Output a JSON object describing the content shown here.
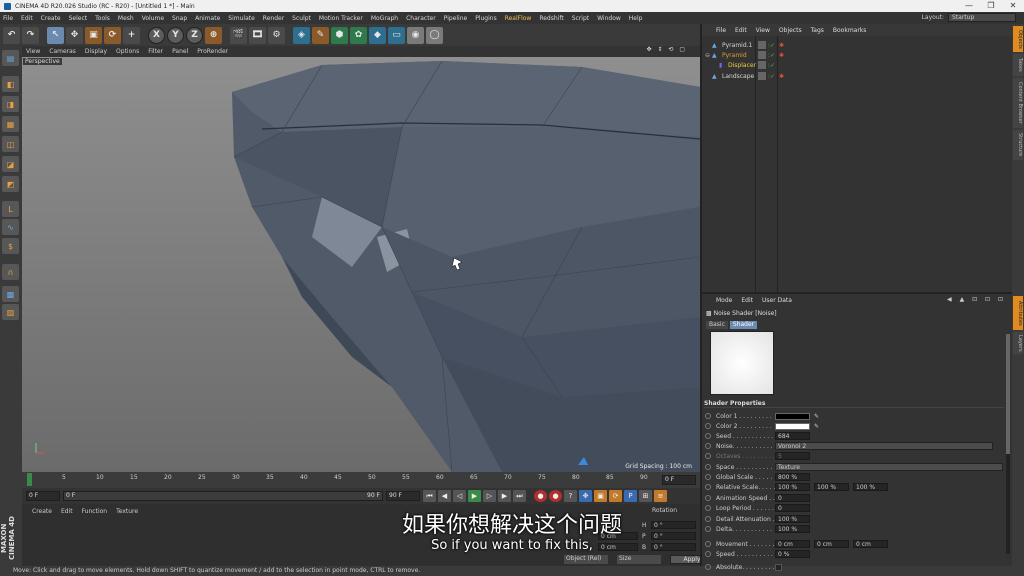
{
  "title_bar": {
    "title": "CINEMA 4D R20.026 Studio (RC - R20) - [Untitled 1 *] - Main",
    "controls": [
      "—",
      "❐",
      "✕"
    ]
  },
  "menu": {
    "items": [
      "File",
      "Edit",
      "Create",
      "Select",
      "Tools",
      "Mesh",
      "Volume",
      "Snap",
      "Animate",
      "Simulate",
      "Render",
      "Sculpt",
      "Motion Tracker",
      "MoGraph",
      "Character",
      "Pipeline",
      "Plugins",
      "RealFlow",
      "Redshift",
      "Script",
      "Window",
      "Help"
    ],
    "highlight": "RealFlow",
    "layout_label": "Layout:",
    "layout_value": "Startup"
  },
  "toolbar": {
    "axes": [
      "X",
      "Y",
      "Z"
    ]
  },
  "viewport": {
    "menu": [
      "View",
      "Cameras",
      "Display",
      "Options",
      "Filter",
      "Panel",
      "ProRender"
    ],
    "label": "Perspective",
    "grid_spacing": "Grid Spacing : 100 cm",
    "nav_icons": "✥ ⇕ ⟲ ▢"
  },
  "timeline": {
    "ticks": [
      "0",
      "5",
      "10",
      "15",
      "20",
      "25",
      "30",
      "35",
      "40",
      "45",
      "50",
      "55",
      "60",
      "65",
      "70",
      "75",
      "80",
      "85",
      "90"
    ],
    "end_field": "0 F"
  },
  "playback": {
    "start": "0 F",
    "start2": "0 F",
    "end": "90 F",
    "end2": "90 F"
  },
  "material_menu": [
    "Create",
    "Edit",
    "Function",
    "Texture"
  ],
  "coords": {
    "header": "Rotation",
    "rows": [
      {
        "l": "H",
        "v": "0 °"
      },
      {
        "l": "P",
        "v": "0 °"
      },
      {
        "l": "B",
        "v": "0 °"
      }
    ],
    "mid_values": [
      "0 cm",
      "0 cm"
    ],
    "mode_select": "Object (Rel)",
    "size_select": "Size",
    "apply": "Apply"
  },
  "logo": "MAXON CINEMA 4D",
  "subtitles": {
    "cn": "如果你想解决这个问题",
    "en": "So if you want to fix this,"
  },
  "status": "Move: Click and drag to move elements. Hold down SHIFT to quantize movement / add to the selection in point mode, CTRL to remove.",
  "object_manager": {
    "menu": [
      "File",
      "Edit",
      "View",
      "Objects",
      "Tags",
      "Bookmarks"
    ],
    "objects": [
      {
        "name": "Pyramid.1",
        "style": ""
      },
      {
        "name": "Pyramid",
        "style": "o"
      },
      {
        "name": "Displacer",
        "style": "y"
      },
      {
        "name": "Landscape",
        "style": ""
      }
    ]
  },
  "right_tabs": [
    "Objects",
    "Takes",
    "Content Browser",
    "Structure",
    "Attributes",
    "Layers"
  ],
  "attributes": {
    "menu": [
      "Mode",
      "Edit",
      "User Data"
    ],
    "title": "Noise Shader [Noise]",
    "tabs": [
      "Basic",
      "Shader"
    ],
    "active_tab": "Shader",
    "section": "Shader Properties",
    "rows": {
      "color1": "Color 1 . . . . . . . . .",
      "color2": "Color 2 . . . . . . . . .",
      "seed_l": "Seed . . . . . . . . . . .",
      "seed_v": "684",
      "noise_l": "Noise. . . . . . . . . . .",
      "noise_v": "Voronoi 2",
      "octaves_l": "Octaves . . . . . . . . .",
      "octaves_v": "5",
      "space_l": "Space . . . . . . . . . .",
      "space_v": "Texture",
      "gscale_l": "Global Scale . . . . .",
      "gscale_v": "800 %",
      "rscale_l": "Relative Scale. . . . .",
      "rscale_v1": "100 %",
      "rscale_v2": "100 %",
      "rscale_v3": "100 %",
      "aspeed_l": "Animation Speed . . .",
      "aspeed_v": "0",
      "loop_l": "Loop Period . . . . . .",
      "loop_v": "0",
      "atten_l": "Detail Attenuation . .",
      "atten_v": "100 %",
      "delta_l": "Delta. . . . . . . . . . .",
      "delta_v": "100 %",
      "move_l": "Movement . . . . . . .",
      "move_v1": "0 cm",
      "move_v2": "0 cm",
      "move_v3": "0 cm",
      "speed_l": "Speed . . . . . . . . . .",
      "speed_v": "0 %",
      "abs_l": "Absolute. . . . . . . . ."
    },
    "nav": "◀ ▲ ⊡ ⊡ ⊡"
  },
  "colors": {
    "accent": "#e08a20",
    "mesh": "#4e5866",
    "viewport_bg": "#8a8a8a"
  }
}
